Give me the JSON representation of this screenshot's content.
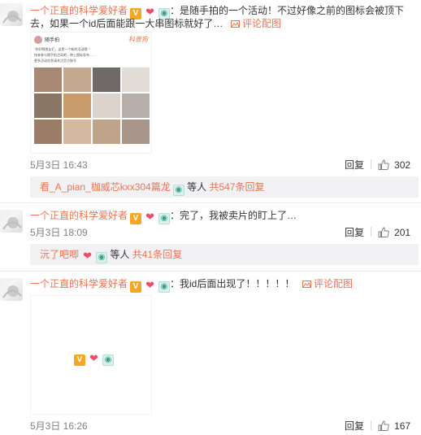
{
  "comments": [
    {
      "username": "一个正直的科学爱好者",
      "text_line1": "：是随手拍的一个活动！不过好像之前的图标会被顶下",
      "text_line2": "去，如果一个id后面能跟一大串图标就好了…",
      "pic_link": "评论配图",
      "date": "5月3日 16:43",
      "reply_label": "回复",
      "likes": "302",
      "sub_reply": {
        "name": "看_A_pian_枷威芯kxx304篇龙",
        "suffix": "等人",
        "count_text": "共547条回复"
      },
      "embedded_post": {
        "author": "随手拍",
        "tag": "科普狗",
        "lines": [
          "“你好啊朋友们，这是一个新的活动哦~”",
          "快来参与随手拍活动吧，带上图标发布……",
          "更多活动信息请关注官方账号"
        ]
      }
    },
    {
      "username": "一个正直的科学爱好者",
      "text": "：完了，我被卖片的盯上了…",
      "date": "5月3日 18:09",
      "reply_label": "回复",
      "likes": "201",
      "sub_reply": {
        "name": "沅了吧唧",
        "suffix": "等人",
        "count_text": "共41条回复"
      }
    },
    {
      "username": "一个正直的科学爱好者",
      "text": "：我id后面出现了！！！！！",
      "pic_link": "评论配图",
      "date": "5月3日 16:26",
      "reply_label": "回复",
      "likes": "167"
    }
  ],
  "icons": {
    "v_badge": "V",
    "heart_badge": "heart",
    "cat_badge": "cat",
    "picture_icon": "picture",
    "thumb_icon": "thumb-up"
  },
  "colors": {
    "link": "#eb7350",
    "reply_bg": "#f2f2f5",
    "v_badge": "#f5a623"
  }
}
